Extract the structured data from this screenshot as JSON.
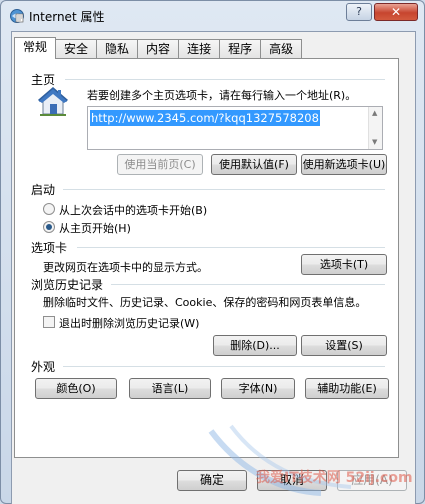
{
  "window": {
    "title": "Internet 属性",
    "help_label": "?",
    "close_label": "✕"
  },
  "tabs": [
    "常规",
    "安全",
    "隐私",
    "内容",
    "连接",
    "程序",
    "高级"
  ],
  "home_page": {
    "heading": "主页",
    "instruction": "若要创建多个主页选项卡，请在每行输入一个地址(R)。",
    "url_value": "http://www.2345.com/?kqq1327578208",
    "use_current_label": "使用当前页(C)",
    "use_default_label": "使用默认值(F)",
    "use_new_tab_label": "使用新选项卡(U)"
  },
  "startup": {
    "heading": "启动",
    "option_last_session": "从上次会话中的选项卡开始(B)",
    "option_home_page": "从主页开始(H)",
    "selected": "option_home_page"
  },
  "tabs_section": {
    "heading": "选项卡",
    "description": "更改网页在选项卡中的显示方式。",
    "button_label": "选项卡(T)"
  },
  "history": {
    "heading": "浏览历史记录",
    "description": "删除临时文件、历史记录、Cookie、保存的密码和网页表单信息。",
    "checkbox_label": "退出时删除浏览历史记录(W)",
    "checkbox_checked": false,
    "delete_label": "删除(D)...",
    "settings_label": "设置(S)"
  },
  "appearance": {
    "heading": "外观",
    "colors_label": "颜色(O)",
    "languages_label": "语言(L)",
    "fonts_label": "字体(N)",
    "accessibility_label": "辅助功能(E)"
  },
  "footer": {
    "ok_label": "确定",
    "cancel_label": "取消",
    "apply_label": "应用(A)"
  },
  "watermark": "我爱IT技术网 52ij.com"
}
